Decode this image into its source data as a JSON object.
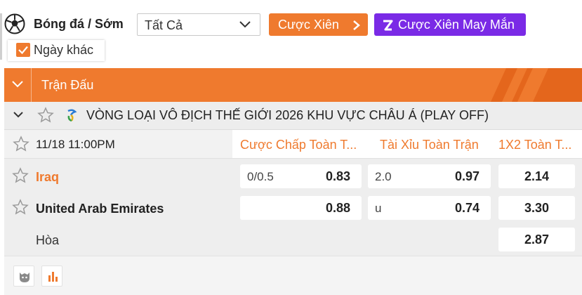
{
  "topbar": {
    "sport_title": "Bóng đá / Sớm",
    "filter_value": "Tất Cả",
    "parlay_label": "Cược Xiên",
    "lucky_parlay_label": "Cược Xiên May Mắn",
    "other_day_label": "Ngày khác",
    "other_day_checked": true
  },
  "section": {
    "title": "Trận Đấu"
  },
  "league": {
    "name": "VÒNG LOẠI VÔ ĐỊCH THẾ GIỚI 2026 KHU VỰC CHÂU Á (PLAY OFF)"
  },
  "markets": {
    "kickoff": "11/18 11:00PM",
    "handicap_title": "Cược Chấp Toàn T...",
    "over_under_title": "Tài Xỉu Toàn Trận",
    "one_x_two_title": "1X2 Toàn T..."
  },
  "match": {
    "home": {
      "name": "Iraq",
      "handicap_line": "0/0.5",
      "handicap_odds": "0.83",
      "ou_line": "2.0",
      "ou_odds": "0.97",
      "x12_odds": "2.14"
    },
    "away": {
      "name": "United Arab Emirates",
      "handicap_odds": "0.88",
      "ou_line": "u",
      "ou_odds": "0.74",
      "x12_odds": "3.30"
    },
    "draw": {
      "name": "Hòa",
      "x12_odds": "2.87"
    }
  },
  "colors": {
    "accent": "#ef7a2e",
    "lucky": "#7a2ae6",
    "row_bg": "#eeeeee"
  }
}
